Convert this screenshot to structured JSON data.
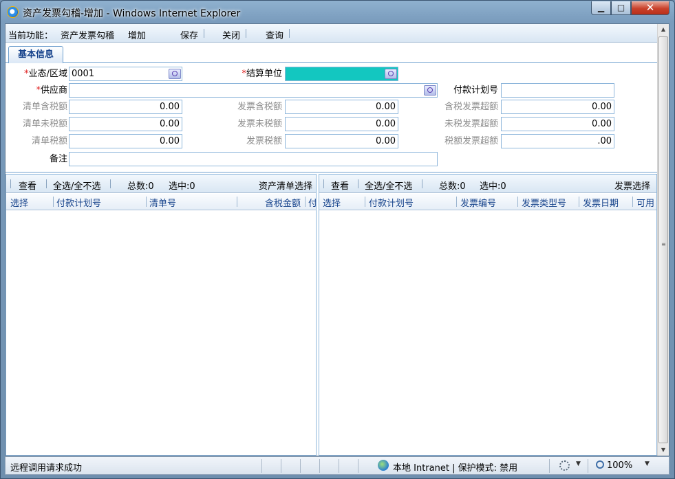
{
  "window": {
    "title": "资产发票勾稽-增加 - Windows Internet Explorer"
  },
  "toolbar": {
    "current_function_label": "当前功能：",
    "function_name": "资产发票勾稽",
    "mode": "增加",
    "save": "保存",
    "close": "关闭",
    "query": "查询"
  },
  "tabs": [
    {
      "label": "基本信息"
    }
  ],
  "form": {
    "required_mark": "*",
    "region": {
      "label": "业态/区域",
      "value": "0001"
    },
    "settle_unit": {
      "label": "结算单位",
      "value": ""
    },
    "supplier": {
      "label": "供应商",
      "value": ""
    },
    "pay_plan_no": {
      "label": "付款计划号",
      "value": ""
    },
    "list_tax_incl": {
      "label": "清单含税额",
      "value": "0.00"
    },
    "inv_tax_incl": {
      "label": "发票含税额",
      "value": "0.00"
    },
    "tax_incl_over": {
      "label": "含税发票超额",
      "value": "0.00"
    },
    "list_tax_excl": {
      "label": "清单未税额",
      "value": "0.00"
    },
    "inv_tax_excl": {
      "label": "发票未税额",
      "value": "0.00"
    },
    "tax_excl_over": {
      "label": "未税发票超额",
      "value": "0.00"
    },
    "list_tax": {
      "label": "清单税额",
      "value": "0.00"
    },
    "inv_tax": {
      "label": "发票税额",
      "value": "0.00"
    },
    "tax_over": {
      "label": "税额发票超额",
      "value": ".00"
    },
    "remark": {
      "label": "备注",
      "value": ""
    }
  },
  "left_panel": {
    "view": "查看",
    "select_all": "全选/全不选",
    "total": "总数:0",
    "selected": "选中:0",
    "title": "资产清单选择",
    "columns": [
      "选择",
      "付款计划号",
      "清单号",
      "含税金额",
      "付"
    ]
  },
  "right_panel": {
    "view": "查看",
    "select_all": "全选/全不选",
    "total": "总数:0",
    "selected": "选中:0",
    "title": "发票选择",
    "columns": [
      "选择",
      "付款计划号",
      "发票编号",
      "发票类型号",
      "发票日期",
      "可用"
    ]
  },
  "status": {
    "message": "远程调用请求成功",
    "zone": "本地 Intranet | 保护模式: 禁用",
    "zoom": "100%"
  },
  "colors": {
    "accent": "#15428b",
    "border": "#8eb6db",
    "highlight": "#13c7c0",
    "required": "#e02020"
  },
  "icons": [
    "ie-icon",
    "minimize-icon",
    "maximize-icon",
    "close-icon",
    "lookup-icon",
    "globe-icon",
    "security-gear-icon",
    "zoom-icon",
    "chevron-down-icon"
  ]
}
